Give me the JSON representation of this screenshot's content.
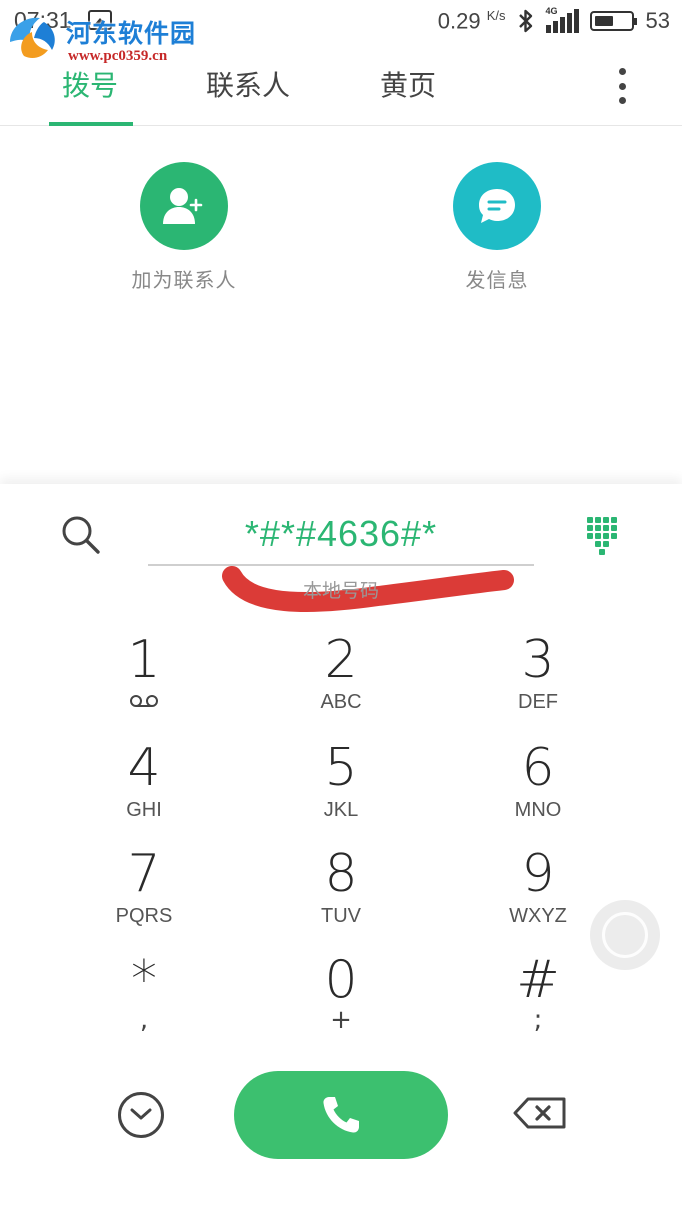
{
  "status_bar": {
    "time": "07:31",
    "net_speed": "0.29",
    "net_unit": "K/s",
    "network_label": "4G",
    "battery_percent": 53,
    "battery_level_text": "53"
  },
  "watermark": {
    "title": "河东软件园",
    "url": "www.pc0359.cn"
  },
  "tabs": [
    {
      "label": "拨号",
      "active": true
    },
    {
      "label": "联系人",
      "active": false
    },
    {
      "label": "黄页",
      "active": false
    }
  ],
  "actions": {
    "add_contact": {
      "label": "加为联系人",
      "icon": "add-person-icon",
      "color": "#2bb673"
    },
    "send_message": {
      "label": "发信息",
      "icon": "message-bubble-icon",
      "color": "#1fbcc6"
    }
  },
  "dialer": {
    "number": "*#*#4636#*",
    "location": "本地号码"
  },
  "keys": [
    {
      "digit": "1",
      "letters": "",
      "sub": "voicemail"
    },
    {
      "digit": "2",
      "letters": "ABC",
      "sub": ""
    },
    {
      "digit": "3",
      "letters": "DEF",
      "sub": ""
    },
    {
      "digit": "4",
      "letters": "GHI",
      "sub": ""
    },
    {
      "digit": "5",
      "letters": "JKL",
      "sub": ""
    },
    {
      "digit": "6",
      "letters": "MNO",
      "sub": ""
    },
    {
      "digit": "7",
      "letters": "PQRS",
      "sub": ""
    },
    {
      "digit": "8",
      "letters": "TUV",
      "sub": ""
    },
    {
      "digit": "9",
      "letters": "WXYZ",
      "sub": ""
    },
    {
      "digit": "*",
      "letters": "",
      "sub": ","
    },
    {
      "digit": "0",
      "letters": "",
      "sub": "+"
    },
    {
      "digit": "#",
      "letters": "",
      "sub": ";"
    }
  ],
  "colors": {
    "accent": "#2bb673",
    "call_button": "#3cc06f",
    "message_button": "#1fbcc6",
    "annotation_mark": "#d9302c"
  }
}
